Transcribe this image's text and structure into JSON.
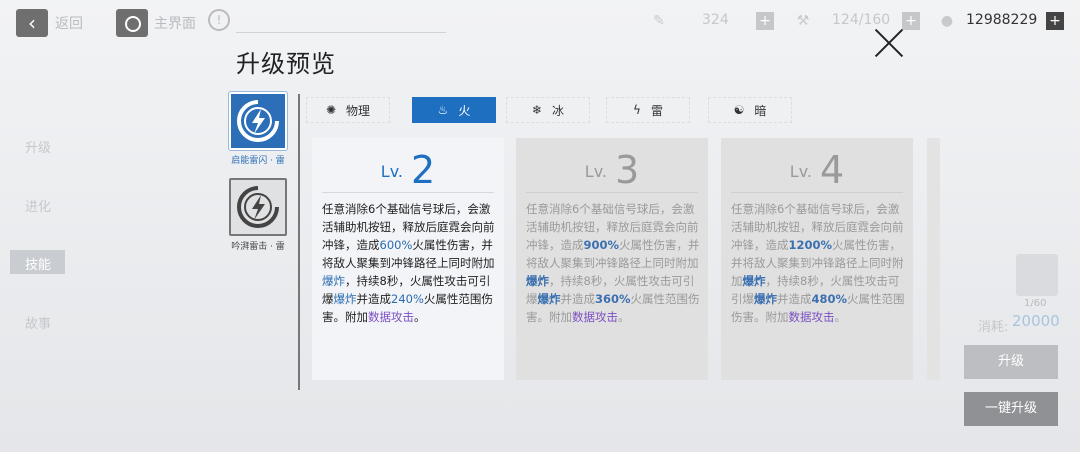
{
  "top_bar": {
    "back_label": "返回",
    "home_label": "主界面",
    "info_symbol": "!",
    "resource1_value": "324",
    "resource2_value": "124/160",
    "coin_value": "12988229",
    "plus_symbol": "+"
  },
  "side_tabs": [
    "升级",
    "进化",
    "技能",
    "故事"
  ],
  "right_panel": {
    "material_count": "1/60",
    "cost_label": "消耗:",
    "cost_value": "20000",
    "upgrade_label": "升级",
    "one_key_label": "一键升级"
  },
  "modal": {
    "title": "升级预览",
    "skills": [
      {
        "name": "启能雷闪 · 雷",
        "active": true,
        "icon": "lightning-skill-icon"
      },
      {
        "name": "吟湃雷击 · 雷",
        "active": false,
        "icon": "lightning-skill-icon"
      }
    ],
    "element_tabs": [
      {
        "label": "物理",
        "icon": "physical-icon",
        "glyph": "✺"
      },
      {
        "label": "火",
        "icon": "fire-icon",
        "glyph": "♨"
      },
      {
        "label": "冰",
        "icon": "ice-icon",
        "glyph": "❄"
      },
      {
        "label": "雷",
        "icon": "thunder-icon",
        "glyph": "ϟ"
      },
      {
        "label": "暗",
        "icon": "dark-icon",
        "glyph": "☯"
      }
    ],
    "active_element": "火",
    "levels": [
      {
        "prefix": "Lv.",
        "level": "2",
        "dmg": "600%",
        "aoe": "240%"
      },
      {
        "prefix": "Lv.",
        "level": "3",
        "dmg": "900%",
        "aoe": "360%"
      },
      {
        "prefix": "Lv.",
        "level": "4",
        "dmg": "1200%",
        "aoe": "480%"
      }
    ],
    "desc": {
      "part1": "任意消除6个基础信号球后，会激活辅助机按钮，释放后庭霓会向前冲锋，造成",
      "part2": "火属性伤害，并将敌人聚集到冲锋路径上同时附加",
      "keyword": "爆炸",
      "part3": "，持续8秒，火属性攻击可引爆",
      "part4": "并造成",
      "part5": "火属性范围伤害。附加",
      "data_attack": "数据攻击",
      "end": "。"
    }
  },
  "colors": {
    "accent": "#1f6fc1",
    "keyword": "#2b6cb0",
    "data_attack": "#7b4fc0"
  }
}
